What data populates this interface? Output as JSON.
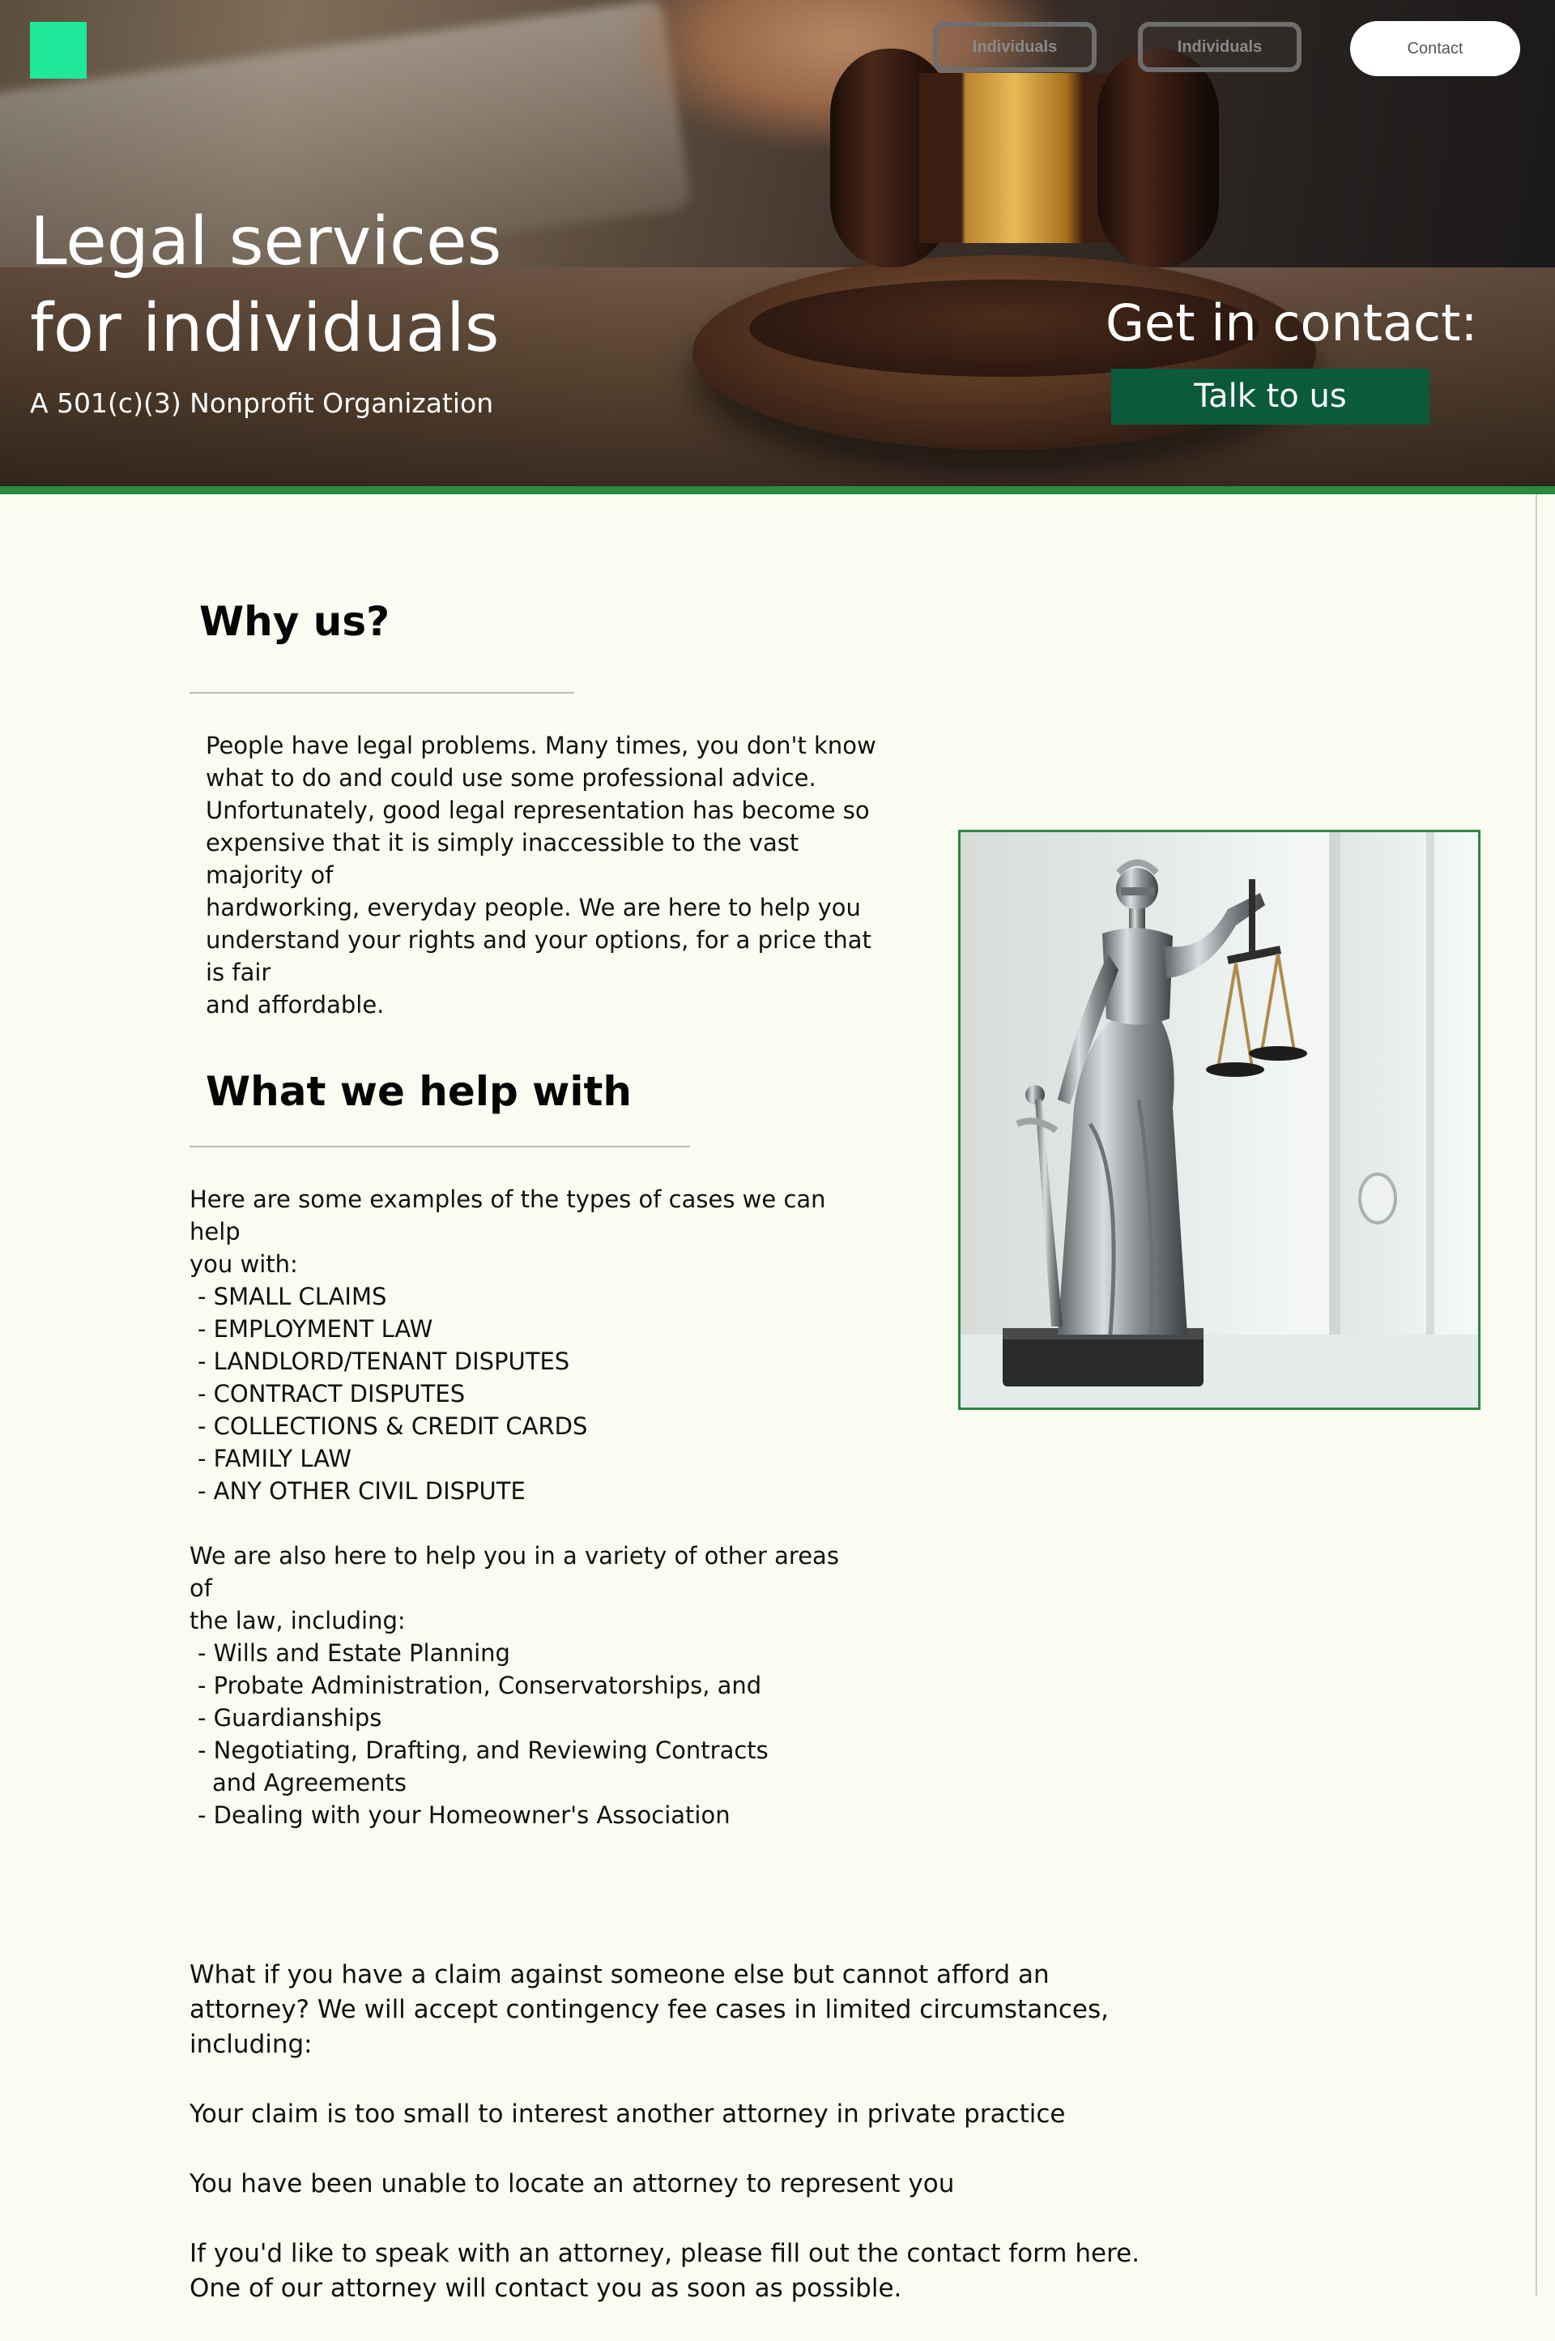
{
  "header": {
    "logo": "logo",
    "nav": [
      {
        "label": "Individuals"
      },
      {
        "label": "Individuals"
      }
    ],
    "contact_label": "Contact"
  },
  "hero": {
    "title_line1": "Legal services",
    "title_line2": "for individuals",
    "subtitle": "A 501(c)(3) Nonprofit Organization",
    "contact_heading": "Get in contact:",
    "cta_label": "Talk to us"
  },
  "why": {
    "title": "Why us?",
    "text": "People have legal problems.  Many times, you don't know\nwhat to do and could use some professional advice.\nUnfortunately, good legal representation has become so\nexpensive that it is simply inaccessible to the vast majority of\nhardworking, everyday people.  We are here to help you\nunderstand your rights and your options, for a price that is fair\nand affordable."
  },
  "help": {
    "title": "What we help with",
    "intro": "Here are some examples of the types of cases we can help\nyou with:",
    "cases": [
      "- SMALL CLAIMS",
      "- EMPLOYMENT LAW",
      "- LANDLORD/TENANT DISPUTES",
      "- CONTRACT DISPUTES",
      "- COLLECTIONS & CREDIT CARDS",
      "- FAMILY LAW",
      "- ANY OTHER CIVIL DISPUTE"
    ],
    "also": "We are also here to help you in a variety of other areas of\nthe law, including:",
    "other_areas": [
      "- Wills and Estate Planning",
      "- Probate Administration, Conservatorships, and",
      "- Guardianships",
      "- Negotiating, Drafting, and Reviewing Contracts and Agreements",
      "- Dealing with your Homeowner's Association"
    ]
  },
  "contingency": {
    "question": "What if you have a claim against someone else but cannot afford an attorney?  We will accept contingency fee cases in limited circumstances, including:",
    "case_1": "Your claim is too small to interest another attorney in private practice",
    "case_2": "You have been unable to locate an attorney to represent you",
    "closing": "If you'd like to speak with an attorney, please fill out the contact form here. One of our attorney will contact you as soon as possible."
  },
  "image": {
    "subject": "lady-justice-statue"
  },
  "colors": {
    "accent_green": "#2a8a3c",
    "cta_green": "#0b5a3c",
    "logo_green": "#1ee89a",
    "page_bg": "#fbfbf1"
  }
}
